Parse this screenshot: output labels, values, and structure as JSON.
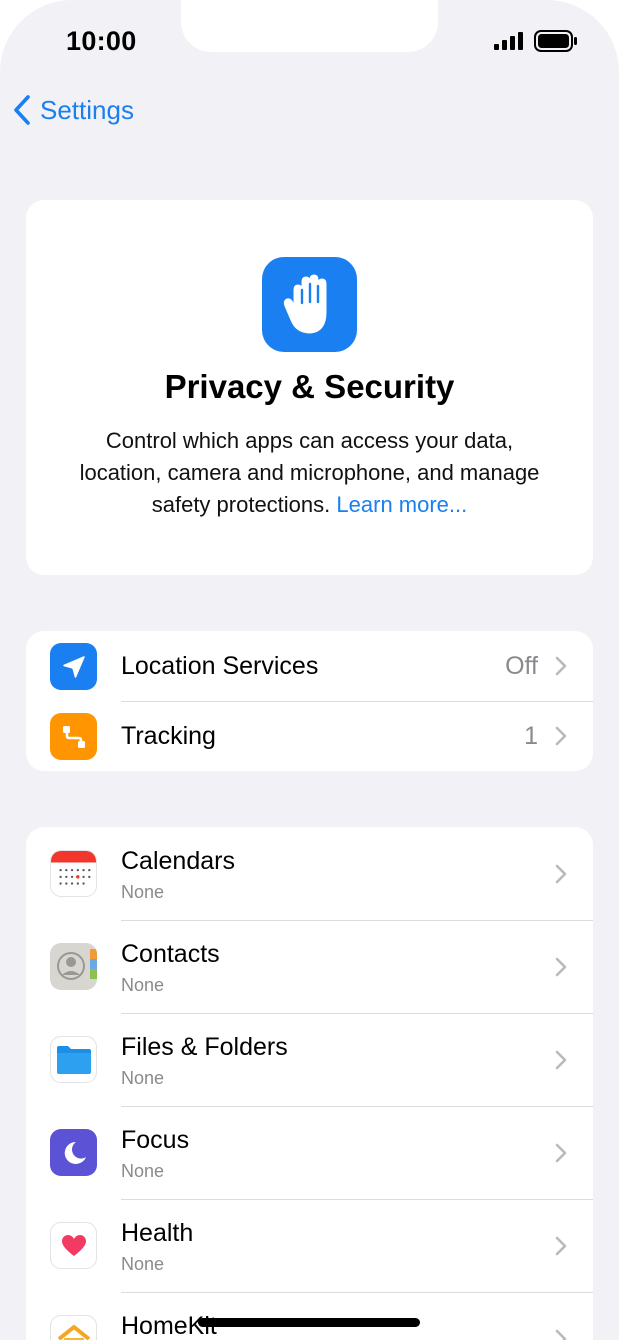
{
  "status_bar": {
    "time": "10:00"
  },
  "nav": {
    "back_label": "Settings"
  },
  "hero": {
    "icon": "hand-raised-icon",
    "title": "Privacy & Security",
    "description": "Control which apps can access your data, location, camera and microphone, and manage safety protections.",
    "link": "Learn more..."
  },
  "group1": [
    {
      "label": "Location Services",
      "value": "Off",
      "icon": "location-arrow-icon",
      "color": "#1a7ff0"
    },
    {
      "label": "Tracking",
      "value": "1",
      "icon": "tracking-icon",
      "color": "#ff9500"
    }
  ],
  "group2": [
    {
      "label": "Calendars",
      "sub": "None",
      "icon": "calendar-icon"
    },
    {
      "label": "Contacts",
      "sub": "None",
      "icon": "contacts-icon"
    },
    {
      "label": "Files & Folders",
      "sub": "None",
      "icon": "folder-icon"
    },
    {
      "label": "Focus",
      "sub": "None",
      "icon": "moon-icon"
    },
    {
      "label": "Health",
      "sub": "None",
      "icon": "heart-icon"
    },
    {
      "label": "HomeKit",
      "sub": "",
      "icon": "home-icon"
    }
  ],
  "colors": {
    "accent": "#1a7ff0",
    "background": "#f1f1f6"
  }
}
